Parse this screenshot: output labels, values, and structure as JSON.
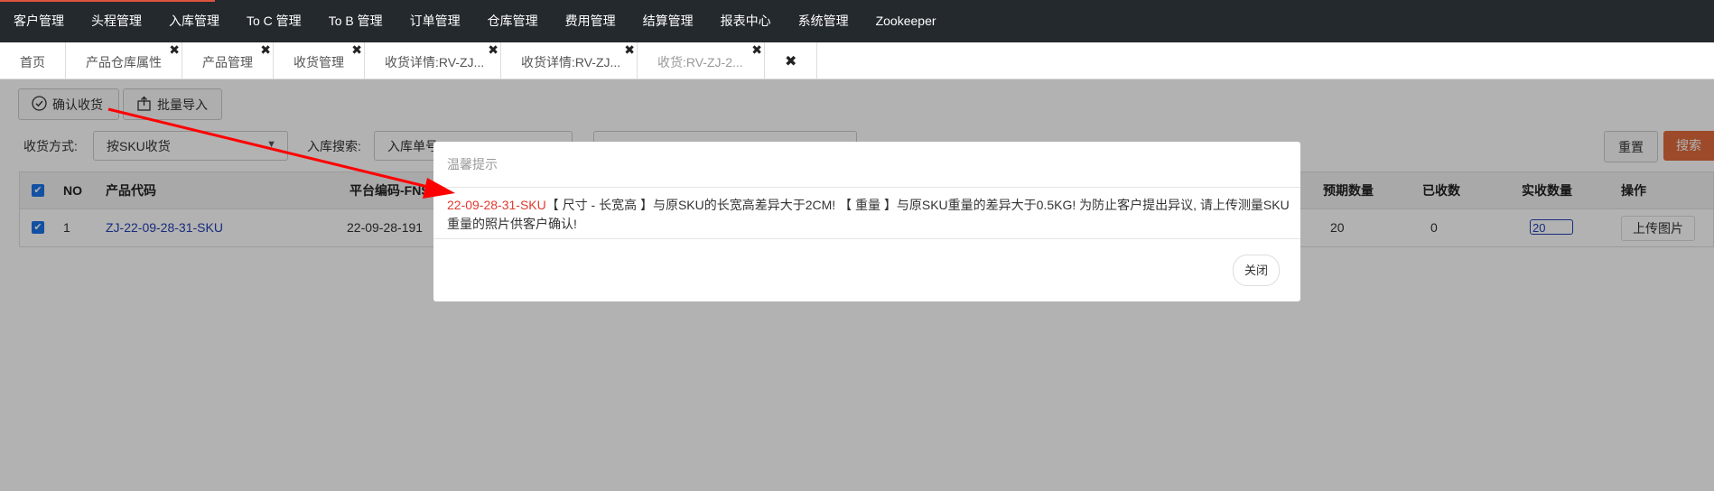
{
  "topnav": {
    "items": [
      "客户管理",
      "头程管理",
      "入库管理",
      "To C 管理",
      "To B 管理",
      "订单管理",
      "仓库管理",
      "费用管理",
      "结算管理",
      "报表中心",
      "系统管理",
      "Zookeeper"
    ],
    "accent_color": "#e0533d"
  },
  "tabs": [
    {
      "label": "首页",
      "closable": false
    },
    {
      "label": "产品仓库属性",
      "closable": true
    },
    {
      "label": "产品管理",
      "closable": true
    },
    {
      "label": "收货管理",
      "closable": true
    },
    {
      "label": "收货详情:RV-ZJ...",
      "closable": true
    },
    {
      "label": "收货详情:RV-ZJ...",
      "closable": true
    },
    {
      "label": "收货:RV-ZJ-2...",
      "closable": true,
      "active": true
    }
  ],
  "tab_close_icon": "close-icon",
  "toolbar": {
    "confirm_label": "确认收货",
    "import_label": "批量导入"
  },
  "filters": {
    "method_label": "收货方式:",
    "method_value": "按SKU收货",
    "search_label": "入库搜索:",
    "search_field_value": "入库单号",
    "reset_label": "重置",
    "search_label_btn": "搜索"
  },
  "table": {
    "headers": [
      "NO",
      "产品代码",
      "平台编码-FNSI",
      "预期数量",
      "已收数",
      "实收数量",
      "操作"
    ],
    "rows": [
      {
        "no": "1",
        "code": "ZJ-22-09-28-31-SKU",
        "fnsku": "22-09-28-191",
        "expected": "20",
        "received": "0",
        "actual": "20",
        "action": "上传图片"
      }
    ]
  },
  "modal": {
    "title": "温馨提示",
    "sku": "22-09-28-31-SKU",
    "message": "【 尺寸 - 长宽高 】与原SKU的长宽高差异大于2CM! 【 重量 】与原SKU重量的差异大于0.5KG! 为防止客户提出异议, 请上传测量SKU重量的照片供客户确认!",
    "close_label": "关闭"
  }
}
